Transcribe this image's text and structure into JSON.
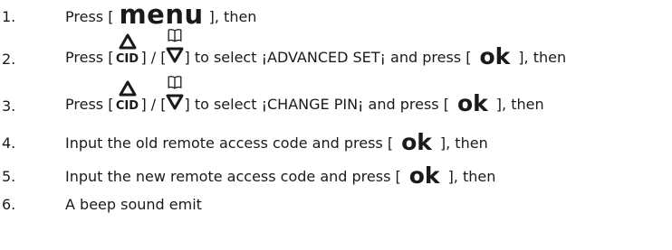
{
  "steps": [
    {
      "num": "1.",
      "pre": "Press [",
      "key": "menu",
      "post": "], then"
    },
    {
      "num": "2.",
      "pre": "Press [",
      "cid": "CID",
      "mid": "] / [",
      "post": "] to select ¡ADVANCED SET¡ and press [",
      "key": "ok",
      "end": "], then"
    },
    {
      "num": "3.",
      "pre": "Press [",
      "cid": "CID",
      "mid": "] / [",
      "post": "] to select ¡CHANGE PIN¡ and press [",
      "key": "ok",
      "end": "], then"
    },
    {
      "num": "4.",
      "pre": "Input the old remote access code and press [",
      "key": "ok",
      "end": "], then"
    },
    {
      "num": "5.",
      "pre": "Input the new remote access code and press [",
      "key": "ok",
      "end": "], then"
    },
    {
      "num": "6.",
      "text": "A beep sound emit"
    }
  ],
  "icons": {
    "up": "triangle-up-icon",
    "down": "triangle-down-icon",
    "phonebook": "open-book-icon"
  }
}
